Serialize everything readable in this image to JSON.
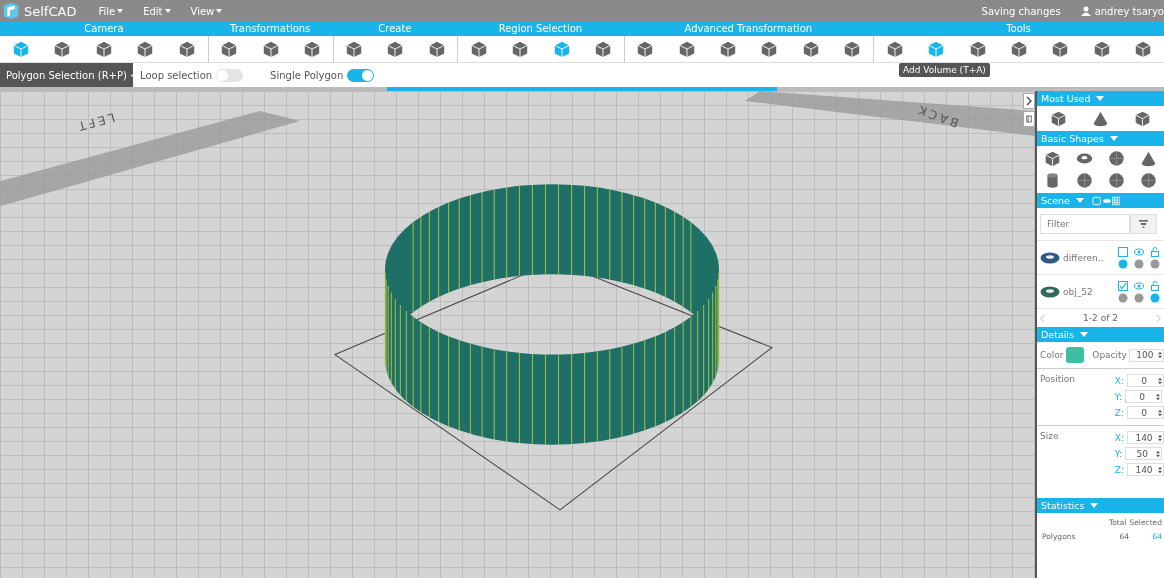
{
  "app": {
    "name": "SelfCAD"
  },
  "menu": [
    {
      "label": "File"
    },
    {
      "label": "Edit"
    },
    {
      "label": "View"
    }
  ],
  "status": "Saving changes",
  "user": "andrey tsaryo",
  "ribbon": [
    {
      "title": "Camera",
      "tools": [
        {
          "selected": true
        },
        {
          "selected": false
        },
        {
          "selected": false
        },
        {
          "selected": false
        },
        {
          "selected": false
        }
      ]
    },
    {
      "title": "Transformations",
      "tools": [
        {
          "selected": false
        },
        {
          "selected": false
        },
        {
          "selected": false
        }
      ]
    },
    {
      "title": "Create",
      "tools": [
        {
          "selected": false
        },
        {
          "selected": false
        },
        {
          "selected": false
        }
      ]
    },
    {
      "title": "Region Selection",
      "tools": [
        {
          "selected": false
        },
        {
          "selected": false
        },
        {
          "selected": true
        },
        {
          "selected": false
        }
      ]
    },
    {
      "title": "Advanced Transformation",
      "tools": [
        {
          "selected": false
        },
        {
          "selected": false
        },
        {
          "selected": false
        },
        {
          "selected": false
        },
        {
          "selected": false
        },
        {
          "selected": false
        }
      ]
    },
    {
      "title": "Tools",
      "tools": [
        {
          "selected": false
        },
        {
          "selected": true
        },
        {
          "selected": false
        },
        {
          "selected": false
        },
        {
          "selected": false
        },
        {
          "selected": false
        },
        {
          "selected": false
        }
      ]
    }
  ],
  "tooltip": "Add Volume (T+A)",
  "mode": {
    "label": "Polygon Selection (R+P)"
  },
  "options": [
    {
      "label": "Loop selection",
      "on": false
    },
    {
      "label": "Single Polygon",
      "on": true
    }
  ],
  "viewport_labels": [
    "LEFT",
    "BACK"
  ],
  "sidebar": {
    "most_used": {
      "title": "Most Used",
      "shapes": [
        {
          "kind": "cube"
        },
        {
          "kind": "cone"
        },
        {
          "kind": "cube"
        }
      ]
    },
    "basic_shapes": {
      "title": "Basic Shapes",
      "shapes": [
        {
          "kind": "cube"
        },
        {
          "kind": "torus"
        },
        {
          "kind": "sphere"
        },
        {
          "kind": "cone"
        },
        {
          "kind": "cylinder"
        },
        {
          "kind": "sphere"
        },
        {
          "kind": "sphere"
        },
        {
          "kind": "sphere"
        }
      ]
    },
    "scene": {
      "title": "Scene",
      "filter_placeholder": "Filter",
      "objects": [
        {
          "name": "differen..",
          "checked": false,
          "color": "#2e5a86"
        },
        {
          "name": "obj_52",
          "checked": true,
          "color": "#2f6b5c"
        }
      ],
      "pager": "1-2 of 2"
    },
    "details": {
      "title": "Details",
      "color_label": "Color",
      "color": "#3dbfa6",
      "opacity_label": "Opacity",
      "opacity": "100",
      "position_label": "Position",
      "position": [
        {
          "axis": "X:",
          "value": "0"
        },
        {
          "axis": "Y:",
          "value": "0"
        },
        {
          "axis": "Z:",
          "value": "0"
        }
      ],
      "size_label": "Size",
      "size": [
        {
          "axis": "X:",
          "value": "140"
        },
        {
          "axis": "Y:",
          "value": "50"
        },
        {
          "axis": "Z:",
          "value": "140"
        }
      ]
    },
    "statistics": {
      "title": "Statistics",
      "columns": [
        "Total",
        "Selected"
      ],
      "rows": [
        {
          "label": "Polygons",
          "total": "64",
          "selected": "64"
        }
      ]
    }
  }
}
